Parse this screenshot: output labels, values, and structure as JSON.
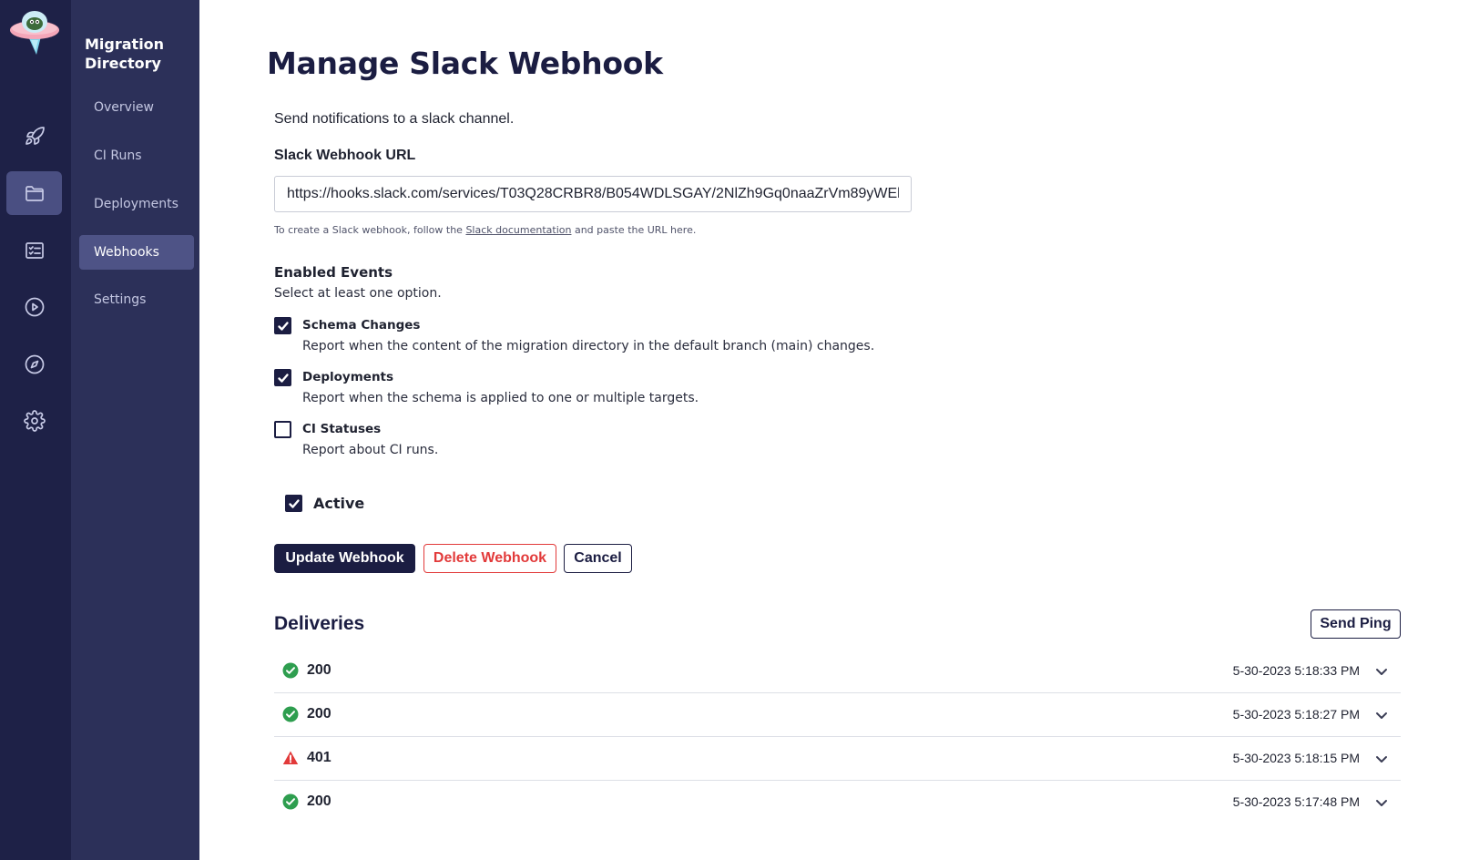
{
  "sidebar": {
    "section_title": "Migration Directory",
    "rail": [
      {
        "icon": "rocket-icon"
      },
      {
        "icon": "folder-icon"
      },
      {
        "icon": "checklist-icon"
      },
      {
        "icon": "play-circle-icon"
      },
      {
        "icon": "compass-icon"
      },
      {
        "icon": "gear-icon"
      }
    ],
    "items": [
      {
        "label": "Overview"
      },
      {
        "label": "CI Runs"
      },
      {
        "label": "Deployments"
      },
      {
        "label": "Webhooks"
      },
      {
        "label": "Settings"
      }
    ],
    "active_item": "Webhooks"
  },
  "page": {
    "title": "Manage Slack Webhook",
    "intro": "Send notifications to a slack channel."
  },
  "form": {
    "url_label": "Slack Webhook URL",
    "url_value": "https://hooks.slack.com/services/T03Q28CRBR8/B054WDLSGAY/2NlZh9Gq0naaZrVm89yWEl",
    "helper_before": "To create a Slack webhook, follow the ",
    "helper_link": "Slack documentation",
    "helper_after": " and paste the URL here.",
    "events_title": "Enabled Events",
    "events_subtitle": "Select at least one option.",
    "events": [
      {
        "name": "Schema Changes",
        "description": "Report when the content of the migration directory in the default branch (main) changes.",
        "checked": true
      },
      {
        "name": "Deployments",
        "description": "Report when the schema is applied to one or multiple targets.",
        "checked": true
      },
      {
        "name": "CI Statuses",
        "description": "Report about CI runs.",
        "checked": false
      }
    ],
    "active_label": "Active",
    "active_checked": true,
    "update_label": "Update Webhook",
    "delete_label": "Delete Webhook",
    "cancel_label": "Cancel"
  },
  "deliveries": {
    "title": "Deliveries",
    "send_ping_label": "Send Ping",
    "rows": [
      {
        "status": "200",
        "ok": true,
        "timestamp": "5-30-2023 5:18:33 PM"
      },
      {
        "status": "200",
        "ok": true,
        "timestamp": "5-30-2023 5:18:27 PM"
      },
      {
        "status": "401",
        "ok": false,
        "timestamp": "5-30-2023 5:18:15 PM"
      },
      {
        "status": "200",
        "ok": true,
        "timestamp": "5-30-2023 5:17:48 PM"
      }
    ]
  },
  "colors": {
    "rail_bg": "#1e2147",
    "subnav_bg": "#2c3059",
    "primary": "#1b1d42",
    "danger": "#e23a3a",
    "success": "#2e9e4f"
  }
}
